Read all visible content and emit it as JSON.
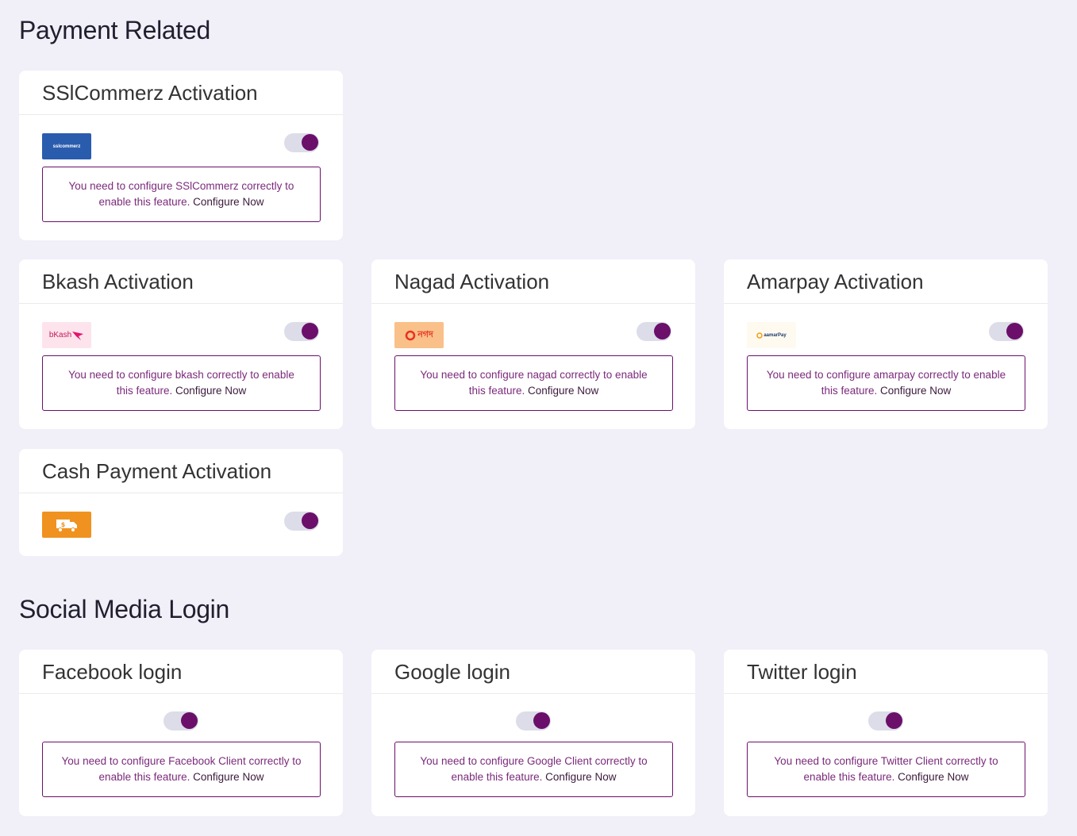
{
  "sections": {
    "payment": {
      "title": "Payment Related"
    },
    "social": {
      "title": "Social Media Login"
    }
  },
  "colors": {
    "accent": "#6b0f6b",
    "background": "#f1eff8",
    "toggle_track": "#dcdde8"
  },
  "payment_cards": {
    "sslcommerz": {
      "title": "SSlCommerz Activation",
      "logo_text": "sslcommerz",
      "notice": "You need to configure SSlCommerz correctly to enable this feature.",
      "link": "Configure Now",
      "enabled": true
    },
    "bkash": {
      "title": "Bkash Activation",
      "logo_text": "bKash",
      "notice": "You need to configure bkash correctly to enable this feature.",
      "link": "Configure Now",
      "enabled": true
    },
    "nagad": {
      "title": "Nagad Activation",
      "logo_text": "নগদ",
      "notice": "You need to configure nagad correctly to enable this feature.",
      "link": "Configure Now",
      "enabled": true
    },
    "amarpay": {
      "title": "Amarpay Activation",
      "logo_text": "aamarPay",
      "notice": "You need to configure amarpay correctly to enable this feature.",
      "link": "Configure Now",
      "enabled": true
    },
    "cash": {
      "title": "Cash Payment Activation",
      "logo_icon": "cash-delivery-truck-icon",
      "enabled": true
    }
  },
  "social_cards": {
    "facebook": {
      "title": "Facebook login",
      "notice": "You need to configure Facebook Client correctly to enable this feature.",
      "link": "Configure Now",
      "enabled": true
    },
    "google": {
      "title": "Google login",
      "notice": "You need to configure Google Client correctly to enable this feature.",
      "link": "Configure Now",
      "enabled": true
    },
    "twitter": {
      "title": "Twitter login",
      "notice": "You need to configure Twitter Client correctly to enable this feature.",
      "link": "Configure Now",
      "enabled": true
    }
  }
}
